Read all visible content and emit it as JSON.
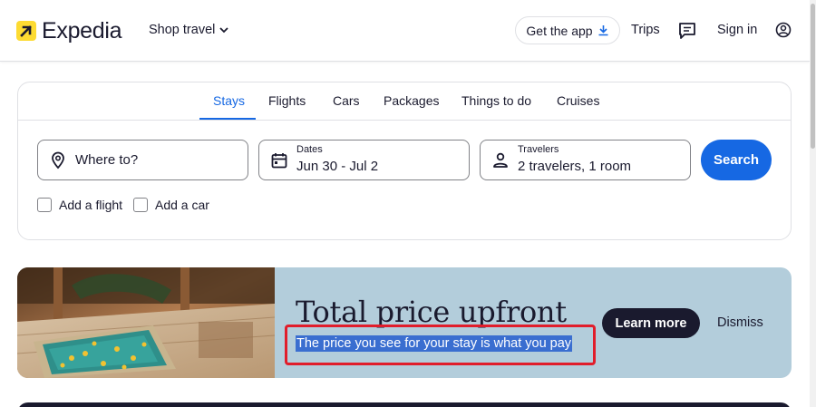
{
  "header": {
    "brand": "Expedia",
    "shop_travel": "Shop travel",
    "get_app": "Get the app",
    "trips": "Trips",
    "sign_in": "Sign in"
  },
  "tabs": [
    {
      "label": "Stays",
      "active": true
    },
    {
      "label": "Flights",
      "active": false
    },
    {
      "label": "Cars",
      "active": false
    },
    {
      "label": "Packages",
      "active": false
    },
    {
      "label": "Things to do",
      "active": false
    },
    {
      "label": "Cruises",
      "active": false
    }
  ],
  "search": {
    "destination_placeholder": "Where to?",
    "dates_label": "Dates",
    "dates_value": "Jun 30 - Jul 2",
    "travelers_label": "Travelers",
    "travelers_value": "2 travelers, 1 room",
    "search_button": "Search",
    "add_flight": "Add a flight",
    "add_car": "Add a car"
  },
  "promo": {
    "title": "Total price upfront",
    "subtitle": "The price you see for your stay is what you pay",
    "learn_more": "Learn more",
    "dismiss": "Dismiss"
  },
  "colors": {
    "accent": "#1668e3",
    "brand_yellow": "#fddb32",
    "dark": "#1a1a2e",
    "promo_bg": "#b3cddb",
    "highlight_red": "#e11d2b"
  },
  "icons": [
    "expedia-logo-icon",
    "chevron-down-icon",
    "download-icon",
    "message-icon",
    "account-icon",
    "location-pin-icon",
    "calendar-icon",
    "person-icon"
  ]
}
